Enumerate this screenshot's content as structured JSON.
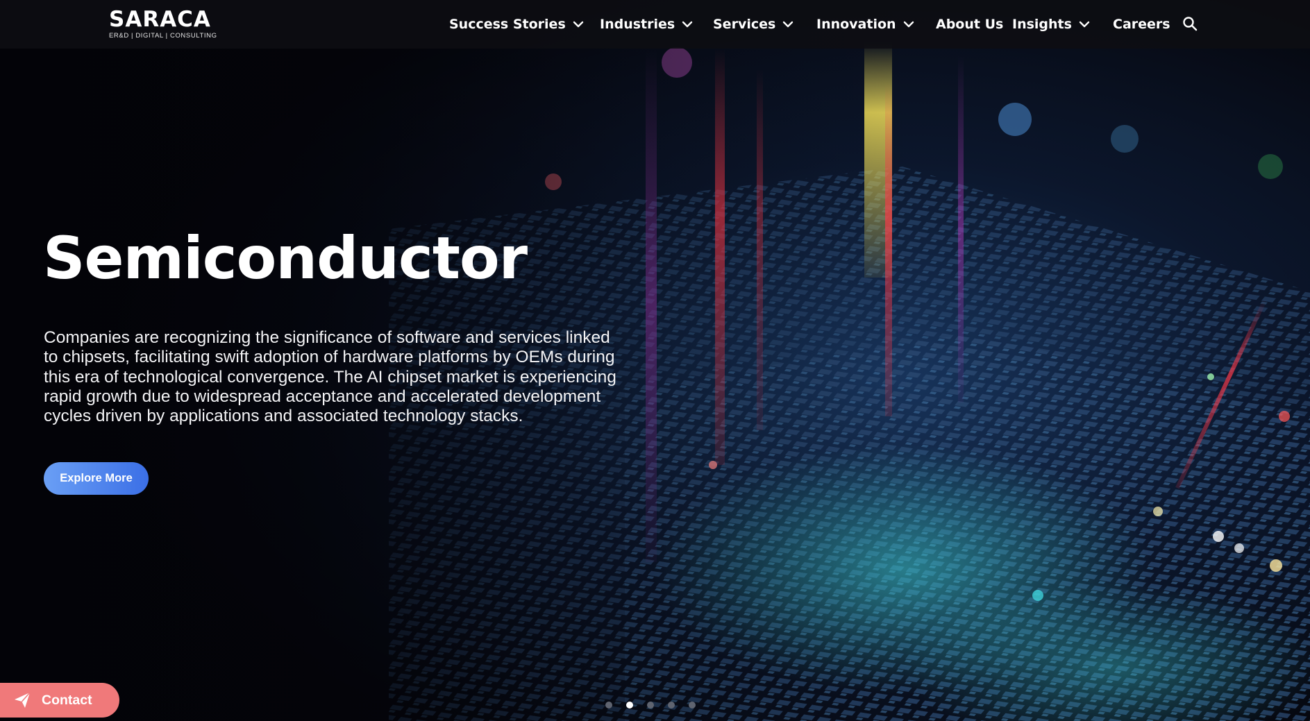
{
  "brand": {
    "name": "SARACA",
    "tagline": "ER&D | DIGITAL | CONSULTING"
  },
  "nav": {
    "items": [
      {
        "label": "Success Stories",
        "has_dropdown": true
      },
      {
        "label": "Industries",
        "has_dropdown": true
      },
      {
        "label": "Services",
        "has_dropdown": true
      },
      {
        "label": "Innovation",
        "has_dropdown": true
      },
      {
        "label": "About Us",
        "has_dropdown": false
      },
      {
        "label": "Insights",
        "has_dropdown": true
      },
      {
        "label": "Careers",
        "has_dropdown": false
      }
    ],
    "search_icon": "search-icon"
  },
  "hero": {
    "title": "Semiconductor",
    "description": "Companies are recognizing the significance of software and services linked to chipsets, facilitating swift adoption of hardware platforms by OEMs during this era of technological convergence. The AI chipset market is experiencing rapid growth due to widespread acceptance and accelerated development cycles driven by applications and associated technology stacks.",
    "cta_label": "Explore More",
    "cta_color": "#3b6fe6"
  },
  "carousel": {
    "slide_count": 5,
    "active_slide": 2
  },
  "contact": {
    "label": "Contact",
    "icon": "paper-plane-icon",
    "color": "#f0797a"
  }
}
